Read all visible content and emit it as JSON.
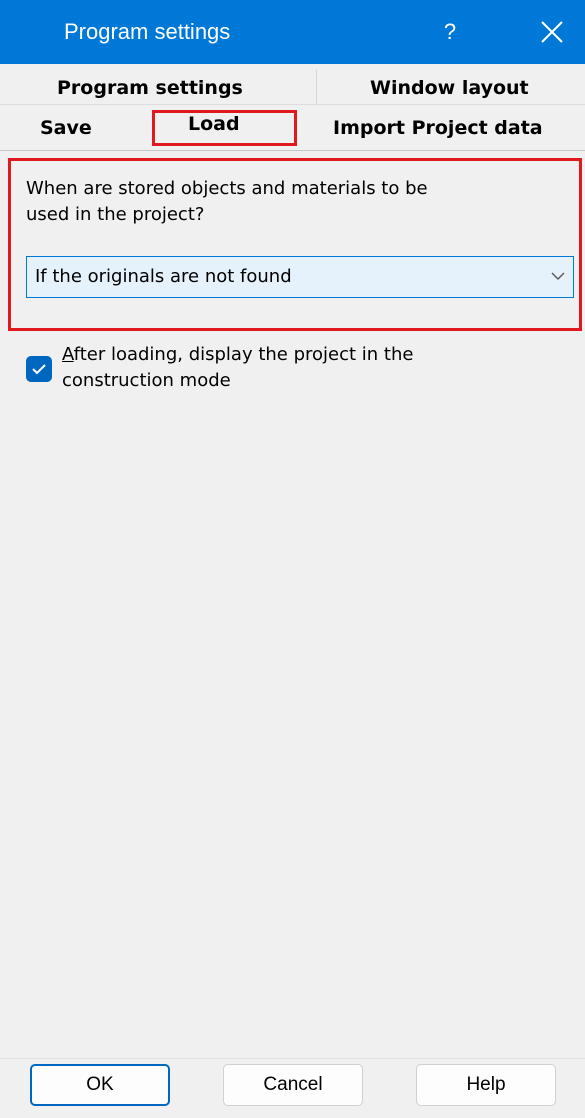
{
  "window": {
    "title": "Program settings",
    "help_label": "?",
    "accent_color": "#0078d7",
    "highlight_color": "#e0191f"
  },
  "tabs": {
    "row1": [
      {
        "label": "Program settings"
      },
      {
        "label": "Window layout"
      }
    ],
    "row2": [
      {
        "label": "Save"
      },
      {
        "label": "Load",
        "selected": true
      },
      {
        "label": "Import Project data"
      }
    ]
  },
  "load": {
    "question": "When are stored objects and materials to be used in the project?",
    "question_line1": "When are stored objects and materials to be",
    "question_line2": "used in the project?",
    "combo_value": "If the originals are not found",
    "checkbox": {
      "checked": true,
      "label_underlined": "A",
      "label_line1_rest": "fter loading, display the project in the",
      "label_line2": "construction mode"
    }
  },
  "buttons": {
    "ok": "OK",
    "cancel": "Cancel",
    "help": "Help"
  },
  "icons": {
    "close": "close-icon",
    "dropdown": "chevron-down-icon",
    "check": "checkmark-icon"
  }
}
